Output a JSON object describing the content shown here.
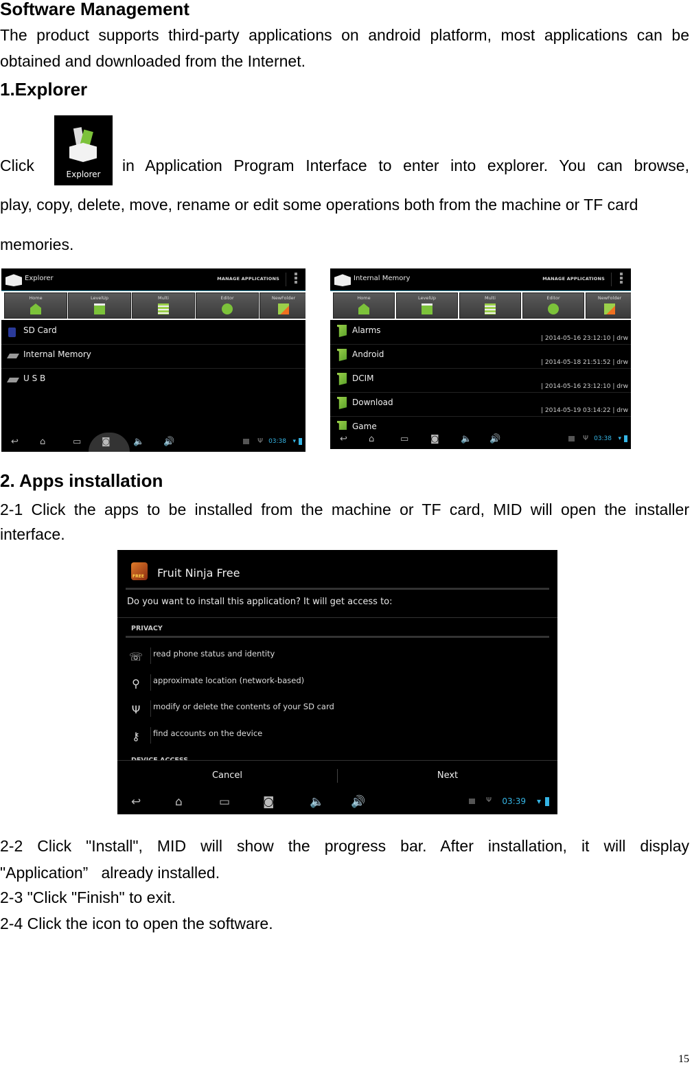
{
  "page": {
    "title": "Software Management",
    "intro": "The product supports third-party applications on android platform, most applications can be obtained and downloaded from the Internet.",
    "intro_line1": "The product supports third-party applications on android platform, most applications can be",
    "intro_line2": "obtained and downloaded from the Internet.",
    "page_number": "15"
  },
  "explorer_section": {
    "heading": "1.Explorer",
    "click_word": "Click",
    "icon_label": "Explorer",
    "text_line1": "in Application Program Interface to enter into explorer. You can browse,",
    "text_line2": "play, copy, delete, move, rename or edit some operations both from the machine or TF card",
    "text_line3": "memories."
  },
  "screen_explorer": {
    "title": "Explorer",
    "manage": "MANAGE APPLICATIONS",
    "toolbar": [
      "Home",
      "LevelUp",
      "Multi",
      "Editor",
      "NewFolder"
    ],
    "items": [
      {
        "name": "SD Card",
        "icon": "sd-card-icon"
      },
      {
        "name": "Internal Memory",
        "icon": "drive-icon"
      },
      {
        "name": "U S B",
        "icon": "drive-icon"
      }
    ],
    "clock": "03:38"
  },
  "screen_internal": {
    "title": "Internal Memory",
    "manage": "MANAGE APPLICATIONS",
    "toolbar": [
      "Home",
      "LevelUp",
      "Multi",
      "Editor",
      "NewFolder"
    ],
    "items": [
      {
        "name": "Alarms",
        "meta": "| 2014-05-16 23:12:10 | drw"
      },
      {
        "name": "Android",
        "meta": "| 2014-05-18 21:51:52 | drw"
      },
      {
        "name": "DCIM",
        "meta": "| 2014-05-16 23:12:10 | drw"
      },
      {
        "name": "Download",
        "meta": "| 2014-05-19 03:14:22 | drw"
      },
      {
        "name": "Game",
        "meta": ""
      }
    ],
    "clock": "03:38"
  },
  "apps_section": {
    "heading": "2. Apps installation",
    "step1_line1": "2-1 Click the apps to be installed from the machine or TF card, MID will open the installer",
    "step1_line2": "interface.",
    "step2_line1": "2-2 Click \"Install\", MID will show the progress bar. After installation, it will display",
    "step2_line2": "\"Application”   already installed.",
    "step3": "2-3 \"Click \"Finish\" to exit.",
    "step4": "2-4 Click the icon to open the software."
  },
  "screen_installer": {
    "app_name": "Fruit Ninja Free",
    "app_badge": "FREE",
    "question": "Do you want to install this application? It will get access to:",
    "privacy_header": "PRIVACY",
    "permissions": [
      {
        "text": "read phone status and identity",
        "icon": "☏"
      },
      {
        "text": "approximate location (network-based)",
        "icon": "⚲"
      },
      {
        "text": "modify or delete the contents of your SD card",
        "icon": "Ψ"
      },
      {
        "text": "find accounts on the device",
        "icon": "⚷"
      }
    ],
    "device_access_header": "DEVICE ACCESS",
    "cancel": "Cancel",
    "next": "Next",
    "clock": "03:39"
  }
}
